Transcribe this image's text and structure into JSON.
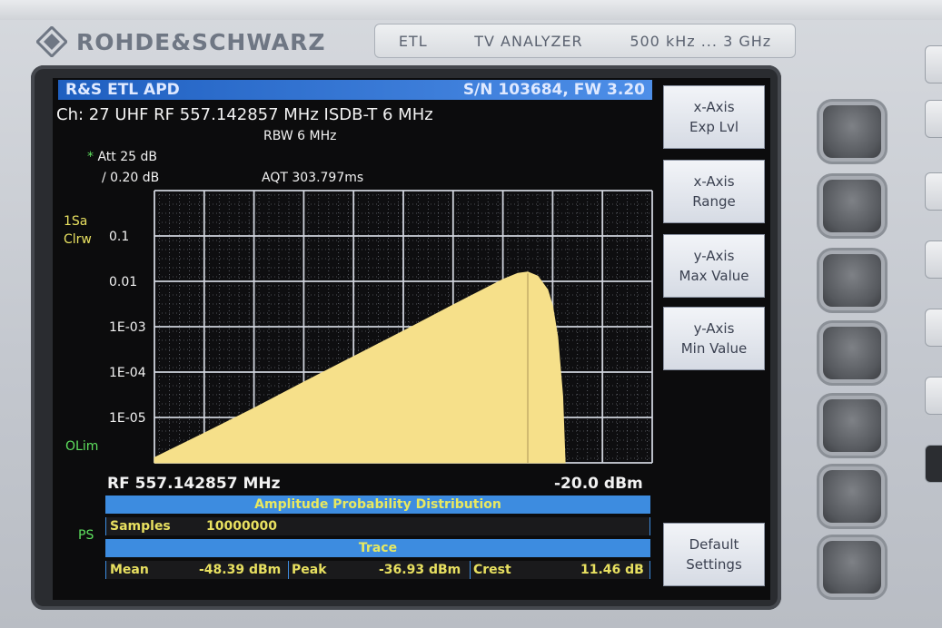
{
  "brand": {
    "name": "ROHDE&SCHWARZ"
  },
  "model_plate": {
    "model": "ETL",
    "type": "TV ANALYZER",
    "range": "500 kHz ... 3 GHz"
  },
  "header": {
    "title": "R&S ETL APD",
    "serial": "S/N 103684, FW 3.20"
  },
  "info": {
    "channel_line": "Ch:  27  UHF  RF 557.142857 MHz  ISDB-T  6 MHz",
    "rbw": "RBW 6 MHz",
    "att_star": "*",
    "att": "Att  25 dB",
    "ref": "/ 0.20 dB",
    "aqt": "AQT  303.797ms"
  },
  "side_labels": {
    "sa": "1Sa",
    "clrw": "Clrw",
    "olim": "OLim",
    "ps": "PS"
  },
  "colors": {
    "trace": "#f6e08a",
    "grid": "#cfd3dc",
    "header_blue": "#3d8ce0",
    "label_yellow": "#e8e060"
  },
  "chart_data": {
    "type": "area",
    "title": "",
    "xlabel": "",
    "ylabel": "",
    "y_scale": "log",
    "y_tick_labels": [
      "0.1",
      "0.01",
      "1E-03",
      "1E-04",
      "1E-05"
    ],
    "y_ticks": [
      0.1,
      0.01,
      0.001,
      0.0001,
      1e-05
    ],
    "ylim": [
      1e-06,
      1
    ],
    "x_divisions": 10,
    "grid": true,
    "series": [
      {
        "x": [
          0.0,
          1.0,
          2.0,
          3.0,
          4.0,
          5.0,
          6.0,
          7.0,
          7.3,
          7.5,
          7.7,
          7.9,
          8.0,
          8.1,
          8.2,
          8.25
        ],
        "values": [
          1.3e-06,
          4.5e-06,
          1.6e-05,
          6e-05,
          0.00022,
          0.0008,
          0.003,
          0.011,
          0.015,
          0.016,
          0.013,
          0.0065,
          0.0028,
          0.0006,
          3e-05,
          1e-06
        ]
      }
    ],
    "bottom_left": "RF 557.142857 MHz",
    "bottom_right": "-20.0 dBm"
  },
  "table": {
    "title": "Amplitude Probability Distribution",
    "samples_label": "Samples",
    "samples_value": "10000000",
    "trace_title": "Trace",
    "mean_label": "Mean",
    "mean_value": "-48.39 dBm",
    "peak_label": "Peak",
    "peak_value": "-36.93 dBm",
    "crest_label": "Crest",
    "crest_value": "11.46 dB"
  },
  "softkeys": [
    {
      "line1": "x-Axis",
      "line2": "Exp Lvl"
    },
    {
      "line1": "x-Axis",
      "line2": "Range"
    },
    {
      "line1": "y-Axis",
      "line2": "Max Value"
    },
    {
      "line1": "y-Axis",
      "line2": "Min Value"
    },
    {
      "line1": "Default",
      "line2": "Settings"
    }
  ]
}
